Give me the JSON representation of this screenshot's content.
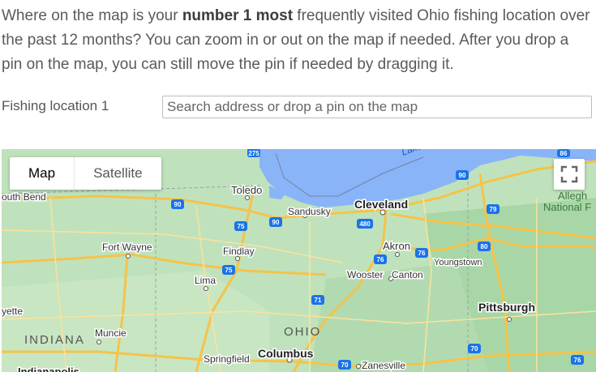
{
  "question": {
    "part1": "Where on the map is your ",
    "bold": "number 1 most",
    "part2": " frequently visited Ohio fishing location over the past 12 months? You can zoom in or out on the map if needed. After you drop a pin on the map, you can still move the pin if needed by dragging it."
  },
  "field": {
    "label": "Fishing location 1",
    "placeholder": "Search address or drop a pin on the map"
  },
  "map_controls": {
    "map_label": "Map",
    "satellite_label": "Satellite"
  },
  "map_labels": {
    "south_bend": "outh Bend",
    "toledo": "Toledo",
    "sandusky": "Sandusky",
    "cleveland": "Cleveland",
    "lake": "Lake",
    "allegheny": "Allegh",
    "national": "National F",
    "fort_wayne": "Fort Wayne",
    "findlay": "Findlay",
    "akron": "Akron",
    "youngstown": "Youngstown",
    "wooster": "Wooster",
    "canton": "Canton",
    "lima": "Lima",
    "ette": "yette",
    "pittsburgh": "Pittsburgh",
    "indiana": "INDIANA",
    "muncie": "Muncie",
    "ohio": "OHIO",
    "springfield": "Springfield",
    "columbus": "Columbus",
    "zanesville": "Zanesville",
    "indianapolis": "Indianapolis"
  },
  "highways": [
    "275",
    "90",
    "75",
    "90",
    "480",
    "76",
    "80",
    "79",
    "75",
    "71",
    "70",
    "70",
    "76",
    "86",
    "90"
  ],
  "colors": {
    "water": "#8ab4f8",
    "land": "#b9dfb8",
    "road": "#f5c34a"
  }
}
